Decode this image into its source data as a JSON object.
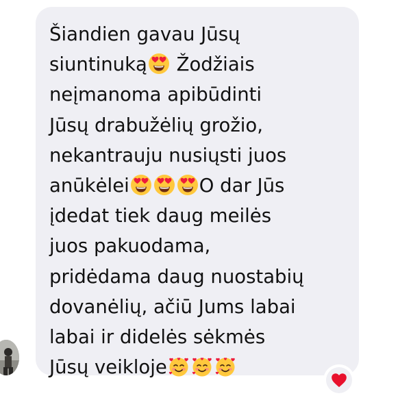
{
  "message": {
    "lines": [
      {
        "parts": [
          {
            "text": "Šiandien gavau Jūsų"
          }
        ]
      },
      {
        "parts": [
          {
            "text": "siuntinuką"
          },
          {
            "emoji": "heart-eyes-emoji"
          },
          {
            "text": " Žodžiais"
          }
        ]
      },
      {
        "parts": [
          {
            "text": "neįmanoma apibūdinti"
          }
        ]
      },
      {
        "parts": [
          {
            "text": "Jūsų drabužėlių grožio,"
          }
        ]
      },
      {
        "parts": [
          {
            "text": "nekantrauju nusiųsti juos"
          }
        ]
      },
      {
        "parts": [
          {
            "text": "anūkėlei"
          },
          {
            "emoji": "heart-eyes-emoji"
          },
          {
            "emoji": "heart-eyes-emoji"
          },
          {
            "emoji": "heart-eyes-emoji"
          },
          {
            "text": "O dar Jūs"
          }
        ]
      },
      {
        "parts": [
          {
            "text": "įdedat tiek daug meilės"
          }
        ]
      },
      {
        "parts": [
          {
            "text": "juos pakuodama,"
          }
        ]
      },
      {
        "parts": [
          {
            "text": "pridėdama daug nuostabių"
          }
        ]
      },
      {
        "parts": [
          {
            "text": "dovanėlių, ačiū Jums labai"
          }
        ]
      },
      {
        "parts": [
          {
            "text": "labai ir didelės sėkmės"
          }
        ]
      },
      {
        "parts": [
          {
            "text": "Jūsų veikloje"
          },
          {
            "emoji": "smiling-face-with-hearts-emoji"
          },
          {
            "emoji": "smiling-face-with-hearts-emoji"
          },
          {
            "emoji": "smiling-face-with-hearts-emoji"
          }
        ]
      }
    ]
  },
  "reaction": {
    "icon": "red-heart-icon"
  },
  "avatar": {
    "icon": "avatar"
  },
  "colors": {
    "bubble": "#efeff4",
    "text": "#111111",
    "heart": "#e8112d",
    "emoji_face": "#ffc83d"
  }
}
